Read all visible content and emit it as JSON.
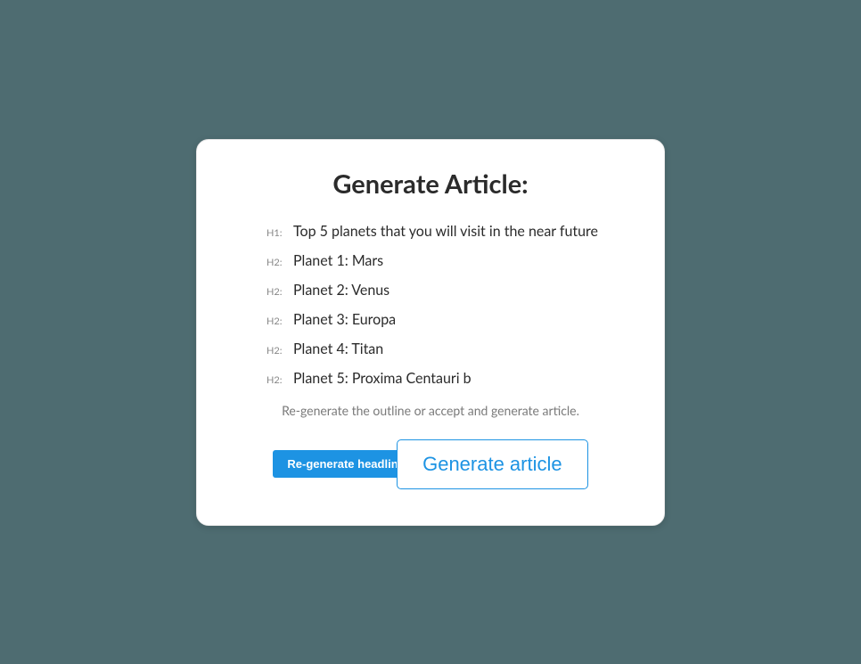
{
  "title": "Generate Article:",
  "outline": [
    {
      "level": "H1:",
      "text": "Top 5 planets that you will visit in the near future"
    },
    {
      "level": "H2:",
      "text": "Planet 1: Mars"
    },
    {
      "level": "H2:",
      "text": "Planet 2: Venus"
    },
    {
      "level": "H2:",
      "text": "Planet 3: Europa"
    },
    {
      "level": "H2:",
      "text": "Planet 4: Titan"
    },
    {
      "level": "H2:",
      "text": "Planet 5: Proxima Centauri b"
    }
  ],
  "instruction": "Re-generate the outline or accept and generate article.",
  "buttons": {
    "regenerate": "Re-generate headlines",
    "generate": "Generate article"
  }
}
